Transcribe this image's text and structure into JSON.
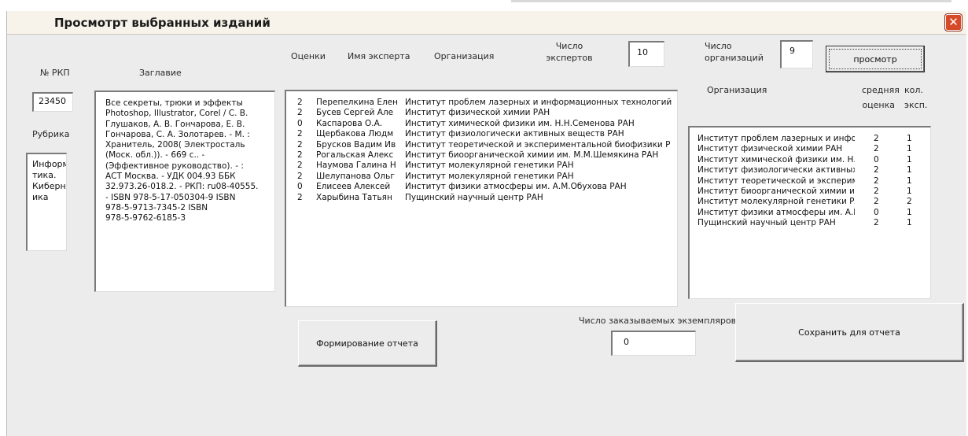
{
  "window": {
    "title": "Просмотрт выбранных изданий",
    "close_glyph": "✕"
  },
  "labels": {
    "rkp_no": "№ РКП",
    "title": "Заглавие",
    "rubric": "Рубрика",
    "ratings": "Оценки",
    "expert_name": "Имя эксперта",
    "organization": "Организация",
    "experts_count_line1": "Число",
    "experts_count_line2": "экспертов",
    "orgs_count_line1": "Число",
    "orgs_count_line2": "организаций",
    "org_list_header": "Организация",
    "avg_rating_line1": "средняя",
    "avg_rating_line2": "оценка",
    "count_exp_line1": "кол.",
    "count_exp_line2": "эксп.",
    "copies_ordered": "Число заказываемых экземпляров"
  },
  "fields": {
    "rkp_no": "23450",
    "experts_count": "10",
    "orgs_count": "9",
    "copies": "0",
    "rubric_lines": [
      "Информа",
      "тика.",
      "Кибернет",
      "ика"
    ],
    "title_lines": [
      "Все секреты, трюки и эффекты",
      "Photoshop, Illustrator, Corel / С. В.",
      "Глушаков, А. В. Гончарова, Е. В.",
      "Гончарова, С. А. Золотарев. - М. :",
      "Хранитель, 2008( Электросталь",
      "(Моск. обл.)). - 669 с.. -",
      "(Эффективное руководство). - :",
      "АСТ Москва. - УДК 004.93 ББК",
      "32.973.26-018.2. - РКП: ru08-40555.",
      "- ISBN 978-5-17-050304-9 ISBN",
      "978-5-9713-7345-2 ISBN",
      "978-5-9762-6185-3"
    ]
  },
  "buttons": {
    "view": "просмотр",
    "report": "Формирование отчета",
    "save": "Сохранить для отчета"
  },
  "experts": [
    {
      "rating": "2",
      "name": "Перепелкина Елен",
      "org": "Институт проблем лазерных и информационных технологий"
    },
    {
      "rating": "2",
      "name": "Бусев Сергей Але",
      "org": "Институт физической химии РАН"
    },
    {
      "rating": "0",
      "name": "Каспарова О.А.",
      "org": "Институт химической физики им. Н.Н.Семенова РАН"
    },
    {
      "rating": "2",
      "name": "Щербакова Людм",
      "org": "Институт физиологически активных веществ РАН"
    },
    {
      "rating": "2",
      "name": "Брусков Вадим Ив",
      "org": "Институт теоретической и экспериментальной биофизики Р"
    },
    {
      "rating": "2",
      "name": "Рогальская Алекс",
      "org": "Институт биоорганической химии им. М.М.Шемякина РАН"
    },
    {
      "rating": "2",
      "name": "Наумова Галина Н",
      "org": "Институт молекулярной генетики РАН"
    },
    {
      "rating": "2",
      "name": "Шелупанова Ольг",
      "org": "Институт молекулярной генетики РАН"
    },
    {
      "rating": "0",
      "name": "Елисеев Алексей",
      "org": "Институт физики атмосферы им. А.М.Обухова РАН"
    },
    {
      "rating": "2",
      "name": "Харыбина Татьян",
      "org": "Пущинский научный центр РАН"
    }
  ],
  "organizations": [
    {
      "name": "Институт проблем лазерных и инфорі",
      "avg": "2",
      "count": "1"
    },
    {
      "name": "Институт физической химии РАН",
      "avg": "2",
      "count": "1"
    },
    {
      "name": "Институт химической физики им. Н.Н.",
      "avg": "0",
      "count": "1"
    },
    {
      "name": "Институт физиологически активных в",
      "avg": "2",
      "count": "1"
    },
    {
      "name": "Институт теоретической и эксперимеі",
      "avg": "2",
      "count": "1"
    },
    {
      "name": "Институт биоорганической химии им.",
      "avg": "2",
      "count": "1"
    },
    {
      "name": "Институт молекулярной генетики РАН",
      "avg": "2",
      "count": "2"
    },
    {
      "name": "Институт физики атмосферы им. А.М.",
      "avg": "0",
      "count": "1"
    },
    {
      "name": "Пущинский научный центр РАН",
      "avg": "2",
      "count": "1"
    }
  ]
}
